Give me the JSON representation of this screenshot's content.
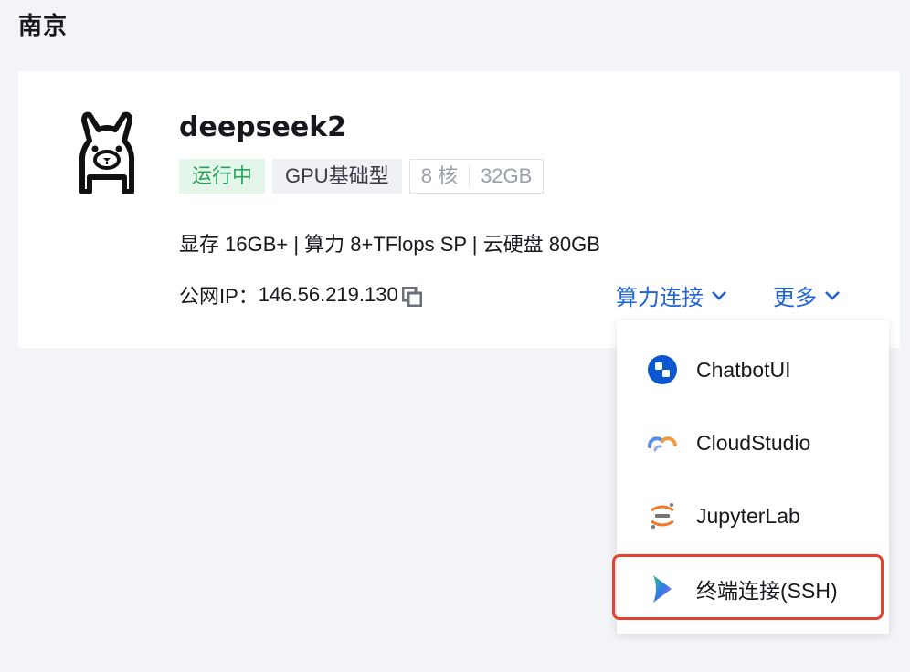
{
  "region": {
    "title": "南京"
  },
  "instance": {
    "name": "deepseek2",
    "tags": {
      "status": "运行中",
      "type": "GPU基础型",
      "cores": "8 核",
      "memory": "32GB"
    },
    "specs": "显存 16GB+ | 算力 8+TFlops SP | 云硬盘 80GB",
    "ip_label": "公网IP：",
    "ip_value": "146.56.219.130"
  },
  "actions": {
    "connect_label": "算力连接",
    "more_label": "更多"
  },
  "dropdown": {
    "items": [
      {
        "label": "ChatbotUI",
        "icon": "chatbotui-icon"
      },
      {
        "label": "CloudStudio",
        "icon": "cloudstudio-icon"
      },
      {
        "label": "JupyterLab",
        "icon": "jupyter-icon"
      },
      {
        "label": "终端连接(SSH)",
        "icon": "terminal-icon",
        "highlighted": true
      }
    ]
  },
  "colors": {
    "accent": "#1f62d6",
    "status_green": "#2ea360",
    "highlight_red": "#e8402e"
  }
}
